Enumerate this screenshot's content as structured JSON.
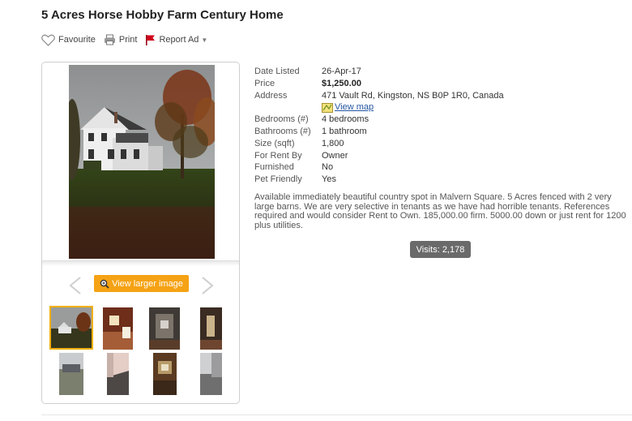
{
  "listing": {
    "title": "5 Acres Horse Hobby Farm Century Home"
  },
  "actions": {
    "favourite": "Favourite",
    "print": "Print",
    "report": "Report Ad"
  },
  "gallery": {
    "view_larger": "View larger image",
    "thumbnail_count": 8,
    "selected_thumbnail": 1
  },
  "details": [
    {
      "label": "Date Listed",
      "value": "26-Apr-17"
    },
    {
      "label": "Price",
      "value": "$1,250.00"
    },
    {
      "label": "Address",
      "value": "471 Vault Rd, Kingston, NS B0P 1R0, Canada"
    },
    {
      "label": "Bedrooms (#)",
      "value": "4 bedrooms"
    },
    {
      "label": "Bathrooms (#)",
      "value": "1 bathroom"
    },
    {
      "label": "Size (sqft)",
      "value": "1,800"
    },
    {
      "label": "For Rent By",
      "value": "Owner"
    },
    {
      "label": "Furnished",
      "value": "No"
    },
    {
      "label": "Pet Friendly",
      "value": "Yes"
    }
  ],
  "map_link": "View map",
  "description": "Available immediately beautiful country spot in Malvern Square. 5 Acres fenced with 2 very large barns. We are very selective in tenants as we have had horrible tenants. References required and would consider Rent to Own. 185,000.00 firm. 5000.00 down or just rent for 1200 plus utilities.",
  "visits": "Visits: 2,178",
  "colors": {
    "accent_orange": "#f5a214",
    "report_flag": "#d0021b",
    "link_blue": "#2355a2",
    "visits_badge": "#6a6a6a"
  }
}
